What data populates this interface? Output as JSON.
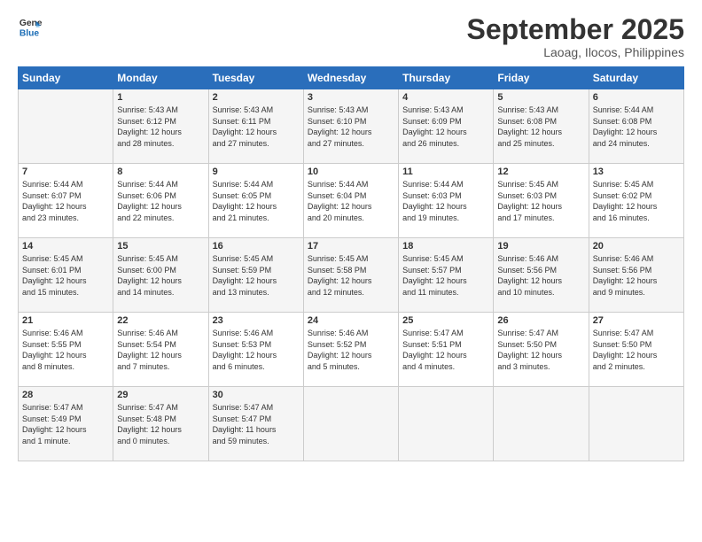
{
  "logo": {
    "line1": "General",
    "line2": "Blue"
  },
  "title": "September 2025",
  "subtitle": "Laoag, Ilocos, Philippines",
  "days_header": [
    "Sunday",
    "Monday",
    "Tuesday",
    "Wednesday",
    "Thursday",
    "Friday",
    "Saturday"
  ],
  "weeks": [
    [
      {
        "num": "",
        "info": ""
      },
      {
        "num": "1",
        "info": "Sunrise: 5:43 AM\nSunset: 6:12 PM\nDaylight: 12 hours\nand 28 minutes."
      },
      {
        "num": "2",
        "info": "Sunrise: 5:43 AM\nSunset: 6:11 PM\nDaylight: 12 hours\nand 27 minutes."
      },
      {
        "num": "3",
        "info": "Sunrise: 5:43 AM\nSunset: 6:10 PM\nDaylight: 12 hours\nand 27 minutes."
      },
      {
        "num": "4",
        "info": "Sunrise: 5:43 AM\nSunset: 6:09 PM\nDaylight: 12 hours\nand 26 minutes."
      },
      {
        "num": "5",
        "info": "Sunrise: 5:43 AM\nSunset: 6:08 PM\nDaylight: 12 hours\nand 25 minutes."
      },
      {
        "num": "6",
        "info": "Sunrise: 5:44 AM\nSunset: 6:08 PM\nDaylight: 12 hours\nand 24 minutes."
      }
    ],
    [
      {
        "num": "7",
        "info": "Sunrise: 5:44 AM\nSunset: 6:07 PM\nDaylight: 12 hours\nand 23 minutes."
      },
      {
        "num": "8",
        "info": "Sunrise: 5:44 AM\nSunset: 6:06 PM\nDaylight: 12 hours\nand 22 minutes."
      },
      {
        "num": "9",
        "info": "Sunrise: 5:44 AM\nSunset: 6:05 PM\nDaylight: 12 hours\nand 21 minutes."
      },
      {
        "num": "10",
        "info": "Sunrise: 5:44 AM\nSunset: 6:04 PM\nDaylight: 12 hours\nand 20 minutes."
      },
      {
        "num": "11",
        "info": "Sunrise: 5:44 AM\nSunset: 6:03 PM\nDaylight: 12 hours\nand 19 minutes."
      },
      {
        "num": "12",
        "info": "Sunrise: 5:45 AM\nSunset: 6:03 PM\nDaylight: 12 hours\nand 17 minutes."
      },
      {
        "num": "13",
        "info": "Sunrise: 5:45 AM\nSunset: 6:02 PM\nDaylight: 12 hours\nand 16 minutes."
      }
    ],
    [
      {
        "num": "14",
        "info": "Sunrise: 5:45 AM\nSunset: 6:01 PM\nDaylight: 12 hours\nand 15 minutes."
      },
      {
        "num": "15",
        "info": "Sunrise: 5:45 AM\nSunset: 6:00 PM\nDaylight: 12 hours\nand 14 minutes."
      },
      {
        "num": "16",
        "info": "Sunrise: 5:45 AM\nSunset: 5:59 PM\nDaylight: 12 hours\nand 13 minutes."
      },
      {
        "num": "17",
        "info": "Sunrise: 5:45 AM\nSunset: 5:58 PM\nDaylight: 12 hours\nand 12 minutes."
      },
      {
        "num": "18",
        "info": "Sunrise: 5:45 AM\nSunset: 5:57 PM\nDaylight: 12 hours\nand 11 minutes."
      },
      {
        "num": "19",
        "info": "Sunrise: 5:46 AM\nSunset: 5:56 PM\nDaylight: 12 hours\nand 10 minutes."
      },
      {
        "num": "20",
        "info": "Sunrise: 5:46 AM\nSunset: 5:56 PM\nDaylight: 12 hours\nand 9 minutes."
      }
    ],
    [
      {
        "num": "21",
        "info": "Sunrise: 5:46 AM\nSunset: 5:55 PM\nDaylight: 12 hours\nand 8 minutes."
      },
      {
        "num": "22",
        "info": "Sunrise: 5:46 AM\nSunset: 5:54 PM\nDaylight: 12 hours\nand 7 minutes."
      },
      {
        "num": "23",
        "info": "Sunrise: 5:46 AM\nSunset: 5:53 PM\nDaylight: 12 hours\nand 6 minutes."
      },
      {
        "num": "24",
        "info": "Sunrise: 5:46 AM\nSunset: 5:52 PM\nDaylight: 12 hours\nand 5 minutes."
      },
      {
        "num": "25",
        "info": "Sunrise: 5:47 AM\nSunset: 5:51 PM\nDaylight: 12 hours\nand 4 minutes."
      },
      {
        "num": "26",
        "info": "Sunrise: 5:47 AM\nSunset: 5:50 PM\nDaylight: 12 hours\nand 3 minutes."
      },
      {
        "num": "27",
        "info": "Sunrise: 5:47 AM\nSunset: 5:50 PM\nDaylight: 12 hours\nand 2 minutes."
      }
    ],
    [
      {
        "num": "28",
        "info": "Sunrise: 5:47 AM\nSunset: 5:49 PM\nDaylight: 12 hours\nand 1 minute."
      },
      {
        "num": "29",
        "info": "Sunrise: 5:47 AM\nSunset: 5:48 PM\nDaylight: 12 hours\nand 0 minutes."
      },
      {
        "num": "30",
        "info": "Sunrise: 5:47 AM\nSunset: 5:47 PM\nDaylight: 11 hours\nand 59 minutes."
      },
      {
        "num": "",
        "info": ""
      },
      {
        "num": "",
        "info": ""
      },
      {
        "num": "",
        "info": ""
      },
      {
        "num": "",
        "info": ""
      }
    ]
  ]
}
